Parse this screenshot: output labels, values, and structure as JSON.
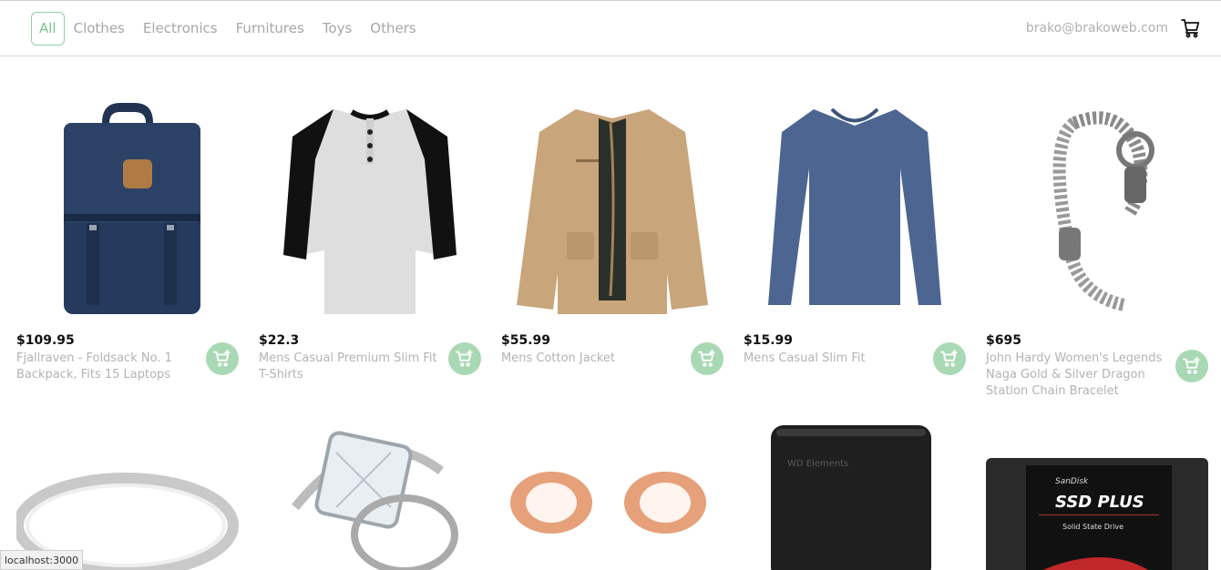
{
  "nav": {
    "categories": [
      "All",
      "Clothes",
      "Electronics",
      "Furnitures",
      "Toys",
      "Others"
    ],
    "active_index": 0,
    "user_email": "brako@brakoweb.com",
    "cart_icon": "shopping-cart-icon"
  },
  "products": [
    {
      "price": "$109.95",
      "title": "Fjallraven - Foldsack No. 1 Backpack, Fits 15 Laptops",
      "image": "backpack"
    },
    {
      "price": "$22.3",
      "title": "Mens Casual Premium Slim Fit T-Shirts",
      "image": "raglan-shirt"
    },
    {
      "price": "$55.99",
      "title": "Mens Cotton Jacket",
      "image": "jacket"
    },
    {
      "price": "$15.99",
      "title": "Mens Casual Slim Fit",
      "image": "long-sleeve-shirt"
    },
    {
      "price": "$695",
      "title": "John Hardy Women's Legends Naga Gold & Silver Dragon Station Chain Bracelet",
      "image": "bracelet"
    }
  ],
  "products_row2": [
    {
      "image": "silver-ring"
    },
    {
      "image": "diamond-ring"
    },
    {
      "image": "rose-gold-plugs"
    },
    {
      "image": "external-hard-drive",
      "brand_text": "WD Elements"
    },
    {
      "image": "ssd",
      "brand_text": "SanDisk",
      "model_text": "SSD PLUS",
      "sub_text": "Solid State Drive"
    }
  ],
  "status_bar": {
    "url": "localhost:3000"
  },
  "colors": {
    "accent": "#8fd1a0",
    "add_button": "#a9d9b4",
    "muted_text": "#b3b3b3"
  }
}
